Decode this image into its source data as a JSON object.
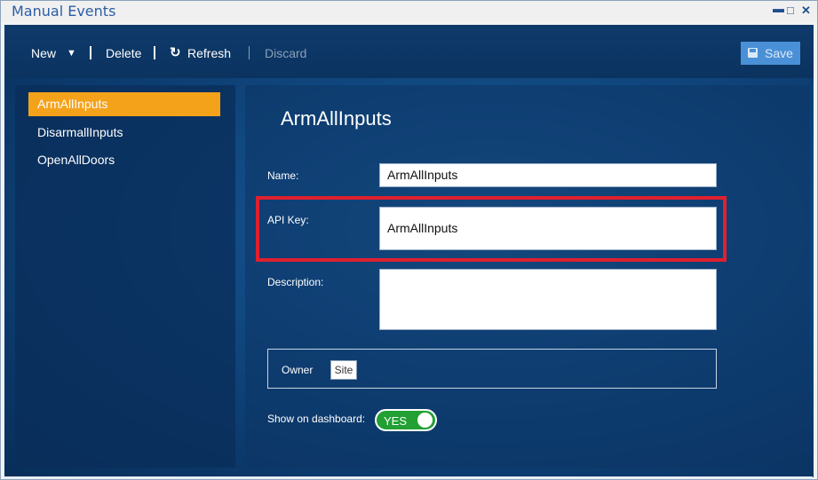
{
  "window": {
    "title": "Manual Events"
  },
  "toolbar": {
    "new_label": "New",
    "delete_label": "Delete",
    "refresh_label": "Refresh",
    "discard_label": "Discard",
    "save_label": "Save"
  },
  "events": {
    "items": [
      {
        "label": "ArmAllInputs"
      },
      {
        "label": "DisarmallInputs"
      },
      {
        "label": "OpenAllDoors"
      }
    ]
  },
  "detail": {
    "heading": "ArmAllInputs",
    "name_label": "Name:",
    "name_value": "ArmAllInputs",
    "api_key_label": "API Key:",
    "api_key_value": "ArmAllInputs",
    "description_label": "Description:",
    "description_value": "",
    "owner_label": "Owner",
    "owner_value": "Site",
    "dashboard_label": "Show on dashboard:",
    "dashboard_toggle": "YES"
  },
  "colors": {
    "selected": "#f5a21b",
    "toggle_on": "#22a033",
    "highlight": "#e0202e",
    "save_button": "#4a90d6"
  }
}
